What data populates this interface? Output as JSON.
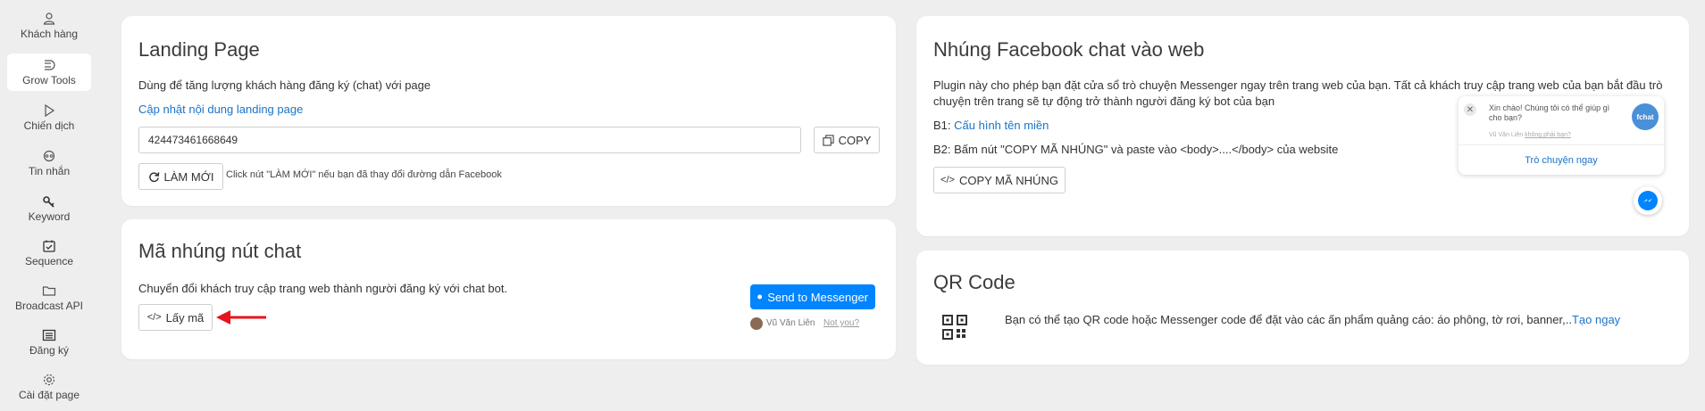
{
  "sidebar": {
    "items": [
      {
        "label": "Khách hàng",
        "icon": "user-icon"
      },
      {
        "label": "Grow Tools",
        "icon": "grow-tools-icon"
      },
      {
        "label": "Chiến dịch",
        "icon": "play-icon"
      },
      {
        "label": "Tin nhắn",
        "icon": "message-icon"
      },
      {
        "label": "Keyword",
        "icon": "key-icon"
      },
      {
        "label": "Sequence",
        "icon": "calendar-check-icon"
      },
      {
        "label": "Broadcast API",
        "icon": "folder-icon"
      },
      {
        "label": "Đăng ký",
        "icon": "form-icon"
      },
      {
        "label": "Cài đặt page",
        "icon": "gear-icon"
      }
    ],
    "active_index": 1
  },
  "landing": {
    "title": "Landing Page",
    "description": "Dùng để tăng lượng khách hàng đăng ký (chat) với page",
    "update_link": "Cập nhật nội dung landing page",
    "page_id": "424473461668649",
    "copy_label": "COPY",
    "refresh_label": "LÀM MỚI",
    "refresh_hint": "Click nút \"LÀM MỚI\" nếu bạn đã thay đổi đường dẫn Facebook"
  },
  "embed_button": {
    "title": "Mã nhúng nút chat",
    "description": "Chuyển đổi khách truy cập trang web thành người đăng ký với chat bot.",
    "get_code_label": "Lấy mã",
    "messenger_label": "Send to Messenger",
    "user_name": "Vũ Văn Liên",
    "not_you": "Not you?",
    "arrow_color": "#e8141b"
  },
  "fb_chat": {
    "title": "Nhúng Facebook chat vào web",
    "description_line1": "Plugin này cho phép bạn đặt cửa sổ trò chuyện Messenger ngay trên trang web của bạn. Tất cả khách truy cập trang web của bạn bắt đầu trò",
    "description_line2": "chuyện trên trang sẽ tự động trở thành người đăng ký bot của bạn",
    "step1_prefix": "B1:",
    "step1_link": "Cấu hình tên miền",
    "step2": "B2: Bấm nút \"COPY MÃ NHÚNG\" và paste vào <body>....</body> của website",
    "copy_embed_label": "COPY MÃ NHÚNG",
    "widget": {
      "greeting": "Xin chào! Chúng tôi có thể giúp gì cho bạn?",
      "brand": "fchat",
      "user_line": "Vũ Văn Liên",
      "not_you": "không phải bạn?",
      "start_label": "Trò chuyện ngay"
    }
  },
  "qr": {
    "title": "QR Code",
    "description": "Bạn có thể tạo QR code hoặc Messenger code để đặt vào các ấn phẩm quảng cáo: áo phông, tờ rơi, banner,..",
    "create_link": "Tạo ngay"
  },
  "colors": {
    "accent": "#1a73c8",
    "messenger": "#0084ff",
    "background": "#eeeeee",
    "card": "#ffffff"
  }
}
